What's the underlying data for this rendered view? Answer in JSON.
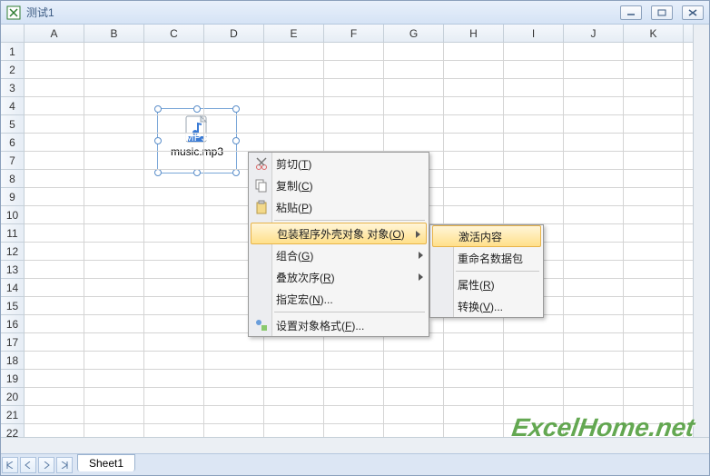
{
  "window": {
    "title": "测试1"
  },
  "columns": [
    "A",
    "B",
    "C",
    "D",
    "E",
    "F",
    "G",
    "H",
    "I",
    "J",
    "K"
  ],
  "rows": [
    "1",
    "2",
    "3",
    "4",
    "5",
    "6",
    "7",
    "8",
    "9",
    "10",
    "11",
    "12",
    "13",
    "14",
    "15",
    "16",
    "17",
    "18",
    "19",
    "20",
    "21",
    "22"
  ],
  "object": {
    "label": "music.mp3",
    "icon_badge": "MP3"
  },
  "context_menu": {
    "items": [
      {
        "label": "剪切",
        "accel": "T",
        "icon": "cut-icon"
      },
      {
        "label": "复制",
        "accel": "C",
        "icon": "copy-icon"
      },
      {
        "label": "粘贴",
        "accel": "P",
        "icon": "paste-icon"
      },
      {
        "label": "包装程序外壳对象 对象",
        "accel": "O",
        "submenu": true,
        "highlight": true
      },
      {
        "label": "组合",
        "accel": "G",
        "submenu": true
      },
      {
        "label": "叠放次序",
        "accel": "R",
        "submenu": true
      },
      {
        "label": "指定宏",
        "accel": "N",
        "ellipsis": true
      },
      {
        "label": "设置对象格式",
        "accel": "F",
        "ellipsis": true,
        "icon": "format-icon"
      }
    ]
  },
  "submenu": {
    "items": [
      {
        "label": "激活内容",
        "highlight": true
      },
      {
        "label": "重命名数据包"
      },
      {
        "label": "属性",
        "accel": "R"
      },
      {
        "label": "转换",
        "accel": "V",
        "ellipsis": true
      }
    ]
  },
  "sheet_tab": "Sheet1",
  "watermark": "ExcelHome.net"
}
